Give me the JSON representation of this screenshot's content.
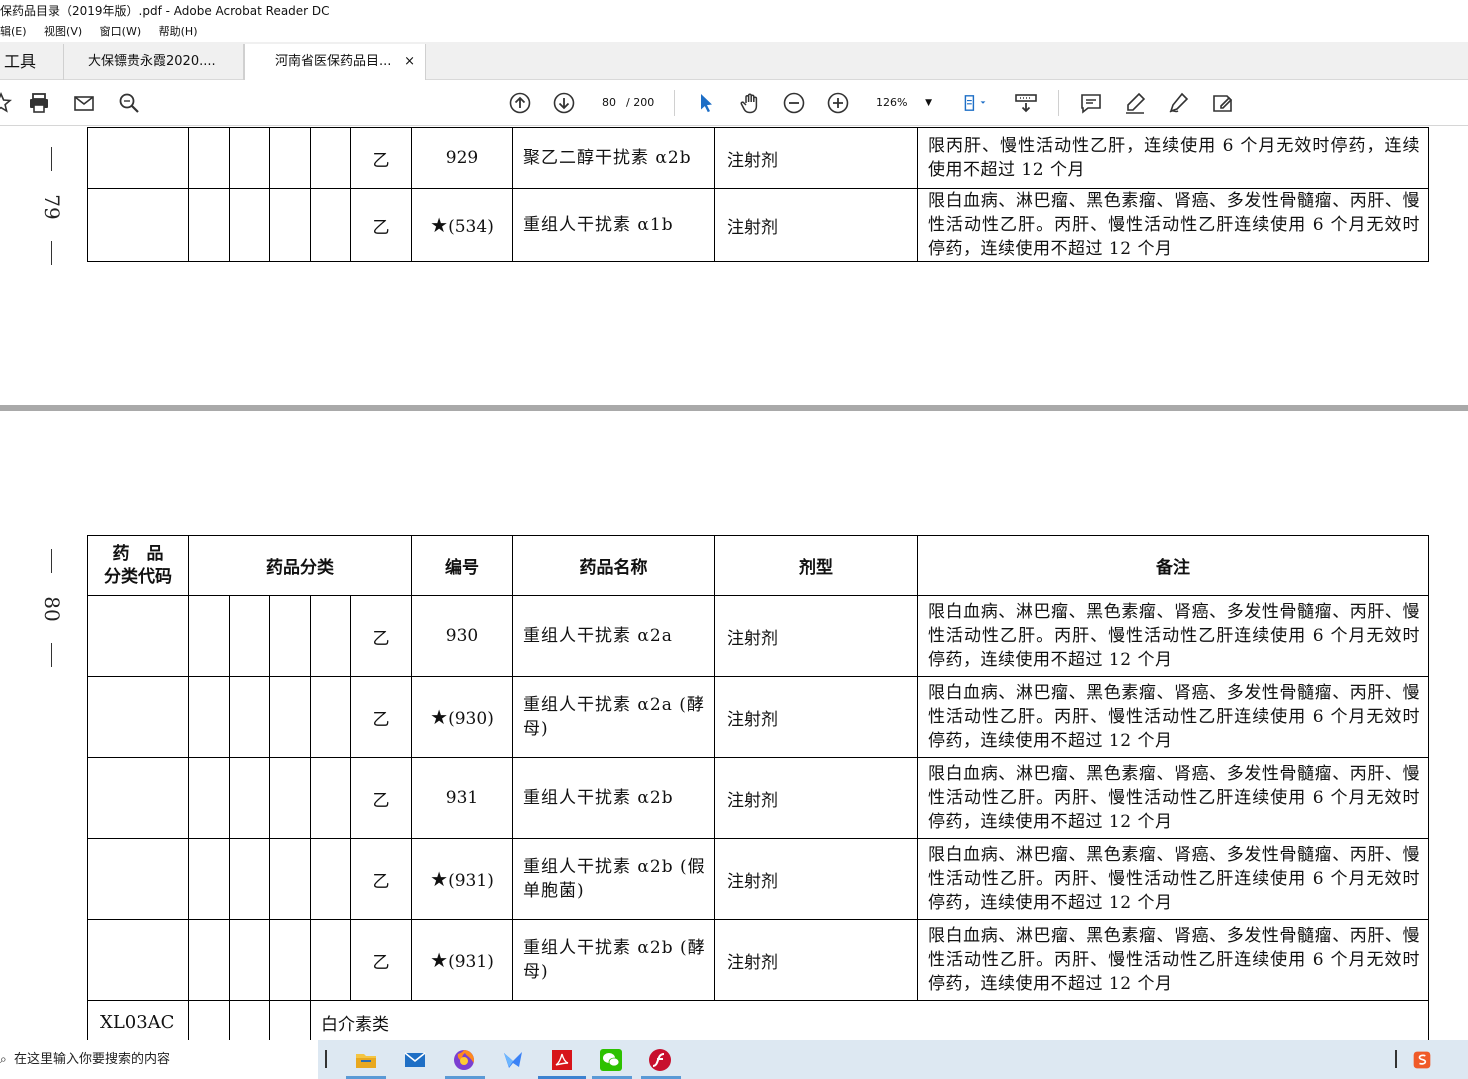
{
  "window": {
    "title": "保药品目录（2019年版）.pdf - Adobe Acrobat Reader DC"
  },
  "menu": [
    "辑(E)",
    "视图(V)",
    "窗口(W)",
    "帮助(H)"
  ],
  "tabs": {
    "tools": "工具",
    "doc1": "大保镖贵永霞2020....",
    "doc2": "河南省医保药品目...",
    "close": "×"
  },
  "toolbar": {
    "current_page": "80",
    "page_total": "/ 200",
    "zoom": "126%"
  },
  "page79": {
    "number": "79",
    "rows": [
      {
        "cls": "乙",
        "code": "929",
        "star": false,
        "name": "聚乙二醇干扰素 α2b",
        "form": "注射剂",
        "note": "限丙肝、慢性活动性乙肝，连续使用 6 个月无效时停药，连续使用不超过 12 个月"
      },
      {
        "cls": "乙",
        "code": "(534)",
        "star": true,
        "name": "重组人干扰素 α1b",
        "form": "注射剂",
        "note": "限白血病、淋巴瘤、黑色素瘤、肾癌、多发性骨髓瘤、丙肝、慢性活动性乙肝。丙肝、慢性活动性乙肝连续使用 6 个月无效时停药，连续使用不超过 12 个月"
      }
    ]
  },
  "page80": {
    "number": "80",
    "headers": {
      "code": "药　品\n分类代码",
      "class": "药品分类",
      "num": "编号",
      "name": "药品名称",
      "form": "剂型",
      "note": "备注"
    },
    "rows": [
      {
        "cls": "乙",
        "code": "930",
        "star": false,
        "name": "重组人干扰素 α2a",
        "form": "注射剂",
        "note": "限白血病、淋巴瘤、黑色素瘤、肾癌、多发性骨髓瘤、丙肝、慢性活动性乙肝。丙肝、慢性活动性乙肝连续使用 6 个月无效时停药，连续使用不超过 12 个月"
      },
      {
        "cls": "乙",
        "code": "(930)",
        "star": true,
        "name": "重组人干扰素 α2a (酵母)",
        "form": "注射剂",
        "note": "限白血病、淋巴瘤、黑色素瘤、肾癌、多发性骨髓瘤、丙肝、慢性活动性乙肝。丙肝、慢性活动性乙肝连续使用 6 个月无效时停药，连续使用不超过 12 个月"
      },
      {
        "cls": "乙",
        "code": "931",
        "star": false,
        "name": "重组人干扰素 α2b",
        "form": "注射剂",
        "note": "限白血病、淋巴瘤、黑色素瘤、肾癌、多发性骨髓瘤、丙肝、慢性活动性乙肝。丙肝、慢性活动性乙肝连续使用 6 个月无效时停药，连续使用不超过 12 个月"
      },
      {
        "cls": "乙",
        "code": "(931)",
        "star": true,
        "name": "重组人干扰素 α2b (假单胞菌)",
        "form": "注射剂",
        "note": "限白血病、淋巴瘤、黑色素瘤、肾癌、多发性骨髓瘤、丙肝、慢性活动性乙肝。丙肝、慢性活动性乙肝连续使用 6 个月无效时停药，连续使用不超过 12 个月"
      },
      {
        "cls": "乙",
        "code": "(931)",
        "star": true,
        "name": "重组人干扰素 α2b (酵母)",
        "form": "注射剂",
        "note": "限白血病、淋巴瘤、黑色素瘤、肾癌、多发性骨髓瘤、丙肝、慢性活动性乙肝。丙肝、慢性活动性乙肝连续使用 6 个月无效时停药，连续使用不超过 12 个月"
      }
    ],
    "group_row": {
      "code": "XL03AC",
      "name": "白介素类"
    }
  },
  "taskbar": {
    "search_placeholder": "在这里输入你要搜索的内容"
  }
}
